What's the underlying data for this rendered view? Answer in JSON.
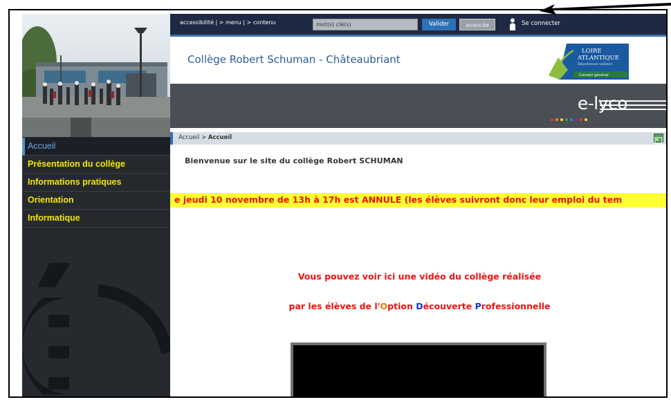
{
  "topbar": {
    "links": "accessibilité | > menu | > contenu",
    "search_placeholder": "mot(s) clé(s)",
    "search_button": "Valider",
    "advanced_button": "avancée",
    "login": "Se connecter",
    "icon": "user-icon"
  },
  "header": {
    "site_title": "Collège Robert Schuman - Châteaubriant",
    "partner_logo": {
      "line1": "LOIRE",
      "line2": "ATLANTIQUE",
      "line3": "Département solidaire",
      "line4": "Conseil général"
    },
    "brand": "e-lyco"
  },
  "sidebar": {
    "items": [
      {
        "label": "Accueil",
        "active": true
      },
      {
        "label": "Présentation du collège",
        "active": false
      },
      {
        "label": "Informations pratiques",
        "active": false
      },
      {
        "label": "Orientation",
        "active": false
      },
      {
        "label": "Informatique",
        "active": false
      }
    ]
  },
  "breadcrumb": {
    "root": "Accueil",
    "separator": ">",
    "current": "Accueil"
  },
  "main": {
    "welcome": "Bienvenue sur le site du collège Robert SCHUMAN",
    "marquee": "e jeudi 10 novembre de 13h à 17h est ANNULE (les élèves suivront donc leur emploi du tem",
    "video_line1": "Vous pouvez voir ici une vidéo du collège réalisée",
    "video_line2_prefix": "par les élèves de l'",
    "video_line2_o": "O",
    "video_line2_option": "ption ",
    "video_line2_d": "D",
    "video_line2_decouverte": "écouverte ",
    "video_line2_p": "P",
    "video_line2_professionnelle": "rofessionnelle"
  },
  "colors": {
    "topbar": "#1e2a44",
    "accent_blue": "#2f71b6",
    "nav_yellow": "#f5e600",
    "highlight_yellow": "#ffff33",
    "alert_red": "#ee1111"
  }
}
